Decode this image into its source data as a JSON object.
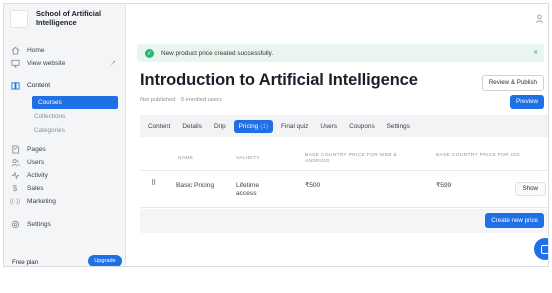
{
  "sidebar": {
    "school_name": "School of Artificial Intelligence",
    "items": [
      {
        "label": "Home",
        "icon": "home-icon"
      },
      {
        "label": "View website",
        "icon": "monitor-icon"
      },
      {
        "label": "Content",
        "icon": "book-icon"
      },
      {
        "label": "Pages",
        "icon": "pages-icon"
      },
      {
        "label": "Users",
        "icon": "users-icon"
      },
      {
        "label": "Activity",
        "icon": "activity-icon"
      },
      {
        "label": "Sales",
        "icon": "dollar-icon"
      },
      {
        "label": "Marketing",
        "icon": "broadcast-icon"
      },
      {
        "label": "Settings",
        "icon": "gear-icon"
      }
    ],
    "content_sub": {
      "courses": "Courses",
      "collections": "Collections",
      "categories": "Categories"
    },
    "plan_label": "Free plan",
    "upgrade_label": "Upgrade"
  },
  "toast": {
    "message": "New product price created successfully.",
    "close": "×"
  },
  "course": {
    "title": "Introduction to Artificial Intelligence",
    "meta": "Not published  ·  0 enrolled users",
    "review_label": "Review & Publish",
    "preview_label": "Preview"
  },
  "tabs": [
    {
      "label": "Content"
    },
    {
      "label": "Details"
    },
    {
      "label": "Drip"
    },
    {
      "label": "Pricing",
      "count": "(1)"
    },
    {
      "label": "Final quiz"
    },
    {
      "label": "Users"
    },
    {
      "label": "Coupons"
    },
    {
      "label": "Settings"
    }
  ],
  "pricing_table": {
    "columns": [
      "NAME",
      "VALIDITY",
      "BASE COUNTRY PRICE FOR WEB & ANDROID",
      "BASE COUNTRY PRICE FOR IOS"
    ],
    "rows": [
      {
        "name": "Basic Pricing",
        "validity": "Lifetime access",
        "web_price": "₹500",
        "ios_price": "₹599",
        "action": "Show"
      }
    ],
    "create_label": "Create new price"
  },
  "colors": {
    "accent": "#1f6fe5",
    "success": "#2bb673",
    "toast_bg": "#e9f6ef"
  }
}
